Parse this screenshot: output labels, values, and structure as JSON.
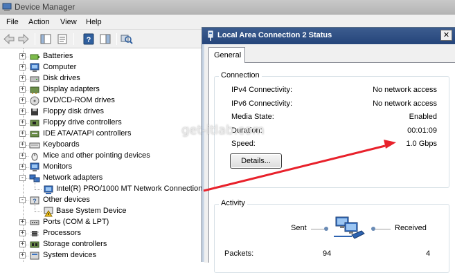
{
  "device_manager": {
    "title": "Device Manager",
    "menu": [
      "File",
      "Action",
      "View",
      "Help"
    ],
    "toolbar_icons": [
      "back-arrow-icon",
      "forward-arrow-icon",
      "console-tree-icon",
      "properties-icon",
      "help-icon",
      "action-pane-icon",
      "scan-hardware-icon"
    ],
    "tree": [
      {
        "label": "Batteries",
        "expander": "+",
        "icon": "battery-icon"
      },
      {
        "label": "Computer",
        "expander": "+",
        "icon": "computer-icon"
      },
      {
        "label": "Disk drives",
        "expander": "+",
        "icon": "disk-drive-icon"
      },
      {
        "label": "Display adapters",
        "expander": "+",
        "icon": "display-adapter-icon"
      },
      {
        "label": "DVD/CD-ROM drives",
        "expander": "+",
        "icon": "dvd-drive-icon"
      },
      {
        "label": "Floppy disk drives",
        "expander": "+",
        "icon": "floppy-disk-icon"
      },
      {
        "label": "Floppy drive controllers",
        "expander": "+",
        "icon": "floppy-controller-icon"
      },
      {
        "label": "IDE ATA/ATAPI controllers",
        "expander": "+",
        "icon": "ide-controller-icon"
      },
      {
        "label": "Keyboards",
        "expander": "+",
        "icon": "keyboard-icon"
      },
      {
        "label": "Mice and other pointing devices",
        "expander": "+",
        "icon": "mouse-icon"
      },
      {
        "label": "Monitors",
        "expander": "+",
        "icon": "monitor-icon"
      },
      {
        "label": "Network adapters",
        "expander": "-",
        "icon": "network-adapter-icon"
      },
      {
        "label": "Intel(R) PRO/1000 MT Network Connection",
        "expander": "",
        "icon": "network-card-icon",
        "child": true
      },
      {
        "label": "Other devices",
        "expander": "-",
        "icon": "other-devices-icon"
      },
      {
        "label": "Base System Device",
        "expander": "",
        "icon": "warning-device-icon",
        "child": true
      },
      {
        "label": "Ports (COM & LPT)",
        "expander": "+",
        "icon": "port-icon"
      },
      {
        "label": "Processors",
        "expander": "+",
        "icon": "processor-icon"
      },
      {
        "label": "Storage controllers",
        "expander": "+",
        "icon": "storage-controller-icon"
      },
      {
        "label": "System devices",
        "expander": "+",
        "icon": "system-device-icon"
      }
    ]
  },
  "status_dialog": {
    "title": "Local Area Connection 2 Status",
    "close_label": "✕",
    "tab": "General",
    "connection": {
      "label": "Connection",
      "rows": [
        {
          "label": "IPv4 Connectivity:",
          "value": "No network access"
        },
        {
          "label": "IPv6 Connectivity:",
          "value": "No network access"
        },
        {
          "label": "Media State:",
          "value": "Enabled"
        },
        {
          "label": "Duration:",
          "value": "00:01:09"
        },
        {
          "label": "Speed:",
          "value": "1.0 Gbps"
        }
      ],
      "details_button": "Details..."
    },
    "activity": {
      "label": "Activity",
      "sent_label": "Sent",
      "received_label": "Received",
      "packets_label": "Packets:",
      "packets_sent": "94",
      "packets_received": "4"
    }
  },
  "watermark": "get-itlab.com",
  "colors": {
    "dialog_titlebar": "#25457a",
    "annotation_arrow": "#e8212b"
  }
}
